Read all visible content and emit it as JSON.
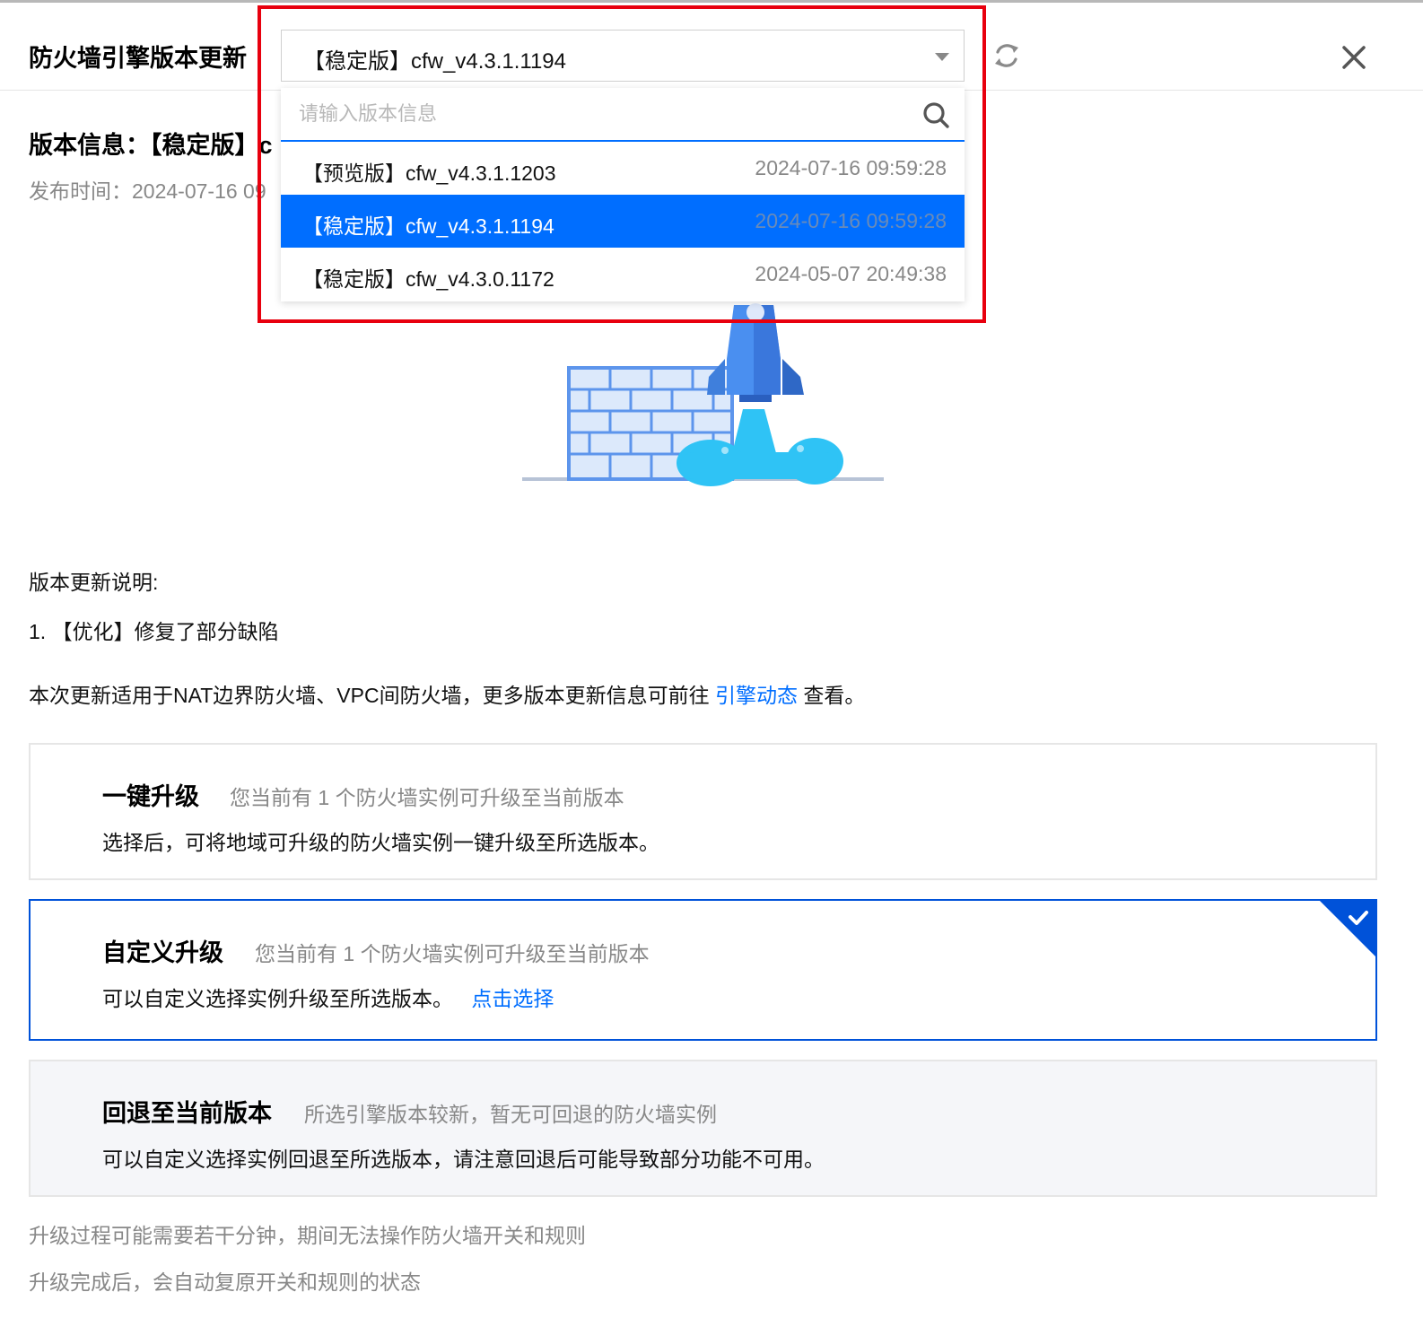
{
  "dialog": {
    "title": "防火墙引擎版本更新",
    "selected_version": "【稳定版】cfw_v4.3.1.1194"
  },
  "version_info": {
    "title": "版本信息：【稳定版】c",
    "release_time": "发布时间：2024-07-16 09"
  },
  "dropdown": {
    "search_placeholder": "请输入版本信息",
    "options": [
      {
        "label": "【预览版】cfw_v4.3.1.1203",
        "date": "2024-07-16 09:59:28",
        "selected": false
      },
      {
        "label": "【稳定版】cfw_v4.3.1.1194",
        "date": "2024-07-16 09:59:28",
        "selected": true
      },
      {
        "label": "【稳定版】cfw_v4.3.0.1172",
        "date": "2024-05-07 20:49:38",
        "selected": false
      }
    ]
  },
  "notes": {
    "title": "版本更新说明:",
    "items": [
      "1. 【优化】修复了部分缺陷"
    ],
    "apply_prefix": "本次更新适用于NAT边界防火墙、VPC间防火墙，更多版本更新信息可前往",
    "apply_link": "引擎动态",
    "apply_suffix": "查看。"
  },
  "options": [
    {
      "title": "一键升级",
      "subtitle": "您当前有 1 个防火墙实例可升级至当前版本",
      "desc": "选择后，可将地域可升级的防火墙实例一键升级至所选版本。",
      "selected": false,
      "disabled": false
    },
    {
      "title": "自定义升级",
      "subtitle": "您当前有 1 个防火墙实例可升级至当前版本",
      "desc": "可以自定义选择实例升级至所选版本。",
      "link": "点击选择",
      "selected": true,
      "disabled": false
    },
    {
      "title": "回退至当前版本",
      "subtitle": "所选引擎版本较新，暂无可回退的防火墙实例",
      "desc": "可以自定义选择实例回退至所选版本，请注意回退后可能导致部分功能不可用。",
      "selected": false,
      "disabled": true
    }
  ],
  "footer": {
    "line1": "升级过程可能需要若干分钟，期间无法操作防火墙开关和规则",
    "line2": "升级完成后，会自动复原开关和规则的状态"
  },
  "colors": {
    "accent": "#006eff",
    "selected_border": "#0052d9",
    "highlight_frame": "#e8000e",
    "muted_text": "#888888"
  },
  "icons": [
    "refresh-icon",
    "close-icon",
    "search-icon",
    "chevron-down-icon",
    "checkmark-icon",
    "rocket-firewall-illustration"
  ]
}
